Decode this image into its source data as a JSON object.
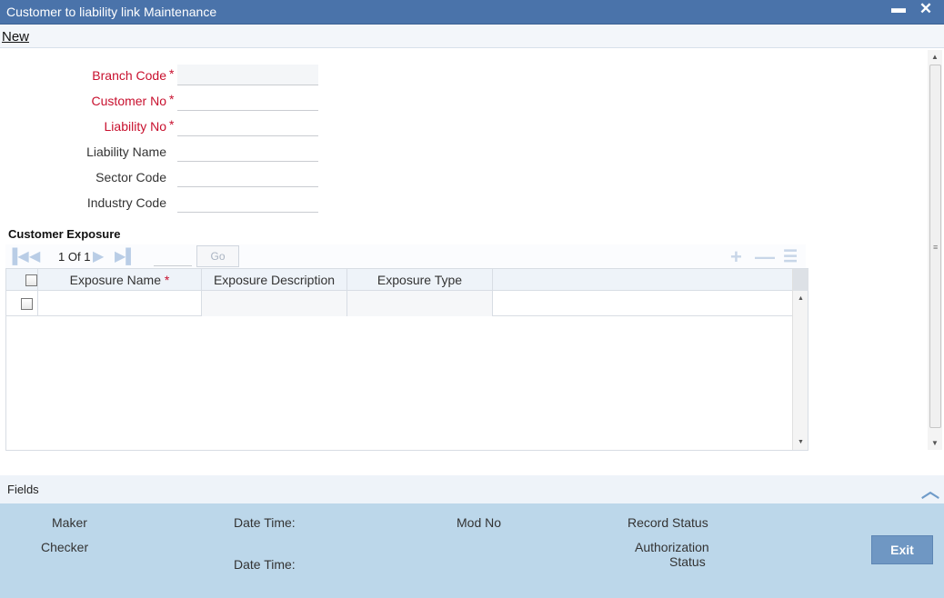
{
  "window": {
    "title": "Customer to liability link Maintenance",
    "minimize_glyph": "▬",
    "close_glyph": "✕"
  },
  "menu": {
    "new_label": "New"
  },
  "form": {
    "branch_code": {
      "label": "Branch Code",
      "value": ""
    },
    "customer_no": {
      "label": "Customer No",
      "value": ""
    },
    "liability_no": {
      "label": "Liability No",
      "value": ""
    },
    "liability_name": {
      "label": "Liability Name",
      "value": ""
    },
    "sector_code": {
      "label": "Sector Code",
      "value": ""
    },
    "industry_code": {
      "label": "Industry Code",
      "value": ""
    },
    "required_marker": "*"
  },
  "exposure": {
    "section_title": "Customer Exposure",
    "pager": {
      "current": "1",
      "of_label": "Of",
      "total": "1",
      "go_label": "Go",
      "page_input": ""
    },
    "columns": [
      "Exposure Name",
      "Exposure Description",
      "Exposure Type"
    ],
    "rows": [
      {
        "name": "",
        "description": "",
        "type": ""
      }
    ]
  },
  "footer": {
    "fields_label": "Fields",
    "maker_label": "Maker",
    "checker_label": "Checker",
    "date_time_label_1": "Date Time:",
    "date_time_label_2": "Date Time:",
    "mod_no_label": "Mod No",
    "record_status_label": "Record Status",
    "authorization_label_line1": "Authorization",
    "authorization_label_line2": "Status",
    "exit_label": "Exit"
  },
  "icons": {
    "first_page": "first-page-icon",
    "prev_page": "prev-page-icon",
    "next_page": "next-page-icon",
    "last_page": "last-page-icon",
    "add_row": "add-row-icon",
    "delete_row": "delete-row-icon",
    "single_view": "single-view-icon",
    "collapse": "chevron-up-icon"
  },
  "colors": {
    "titlebar": "#4a73aa",
    "required": "#c8102e",
    "audit_panel": "#bcd7ea",
    "exit_button": "#6f97c3"
  }
}
